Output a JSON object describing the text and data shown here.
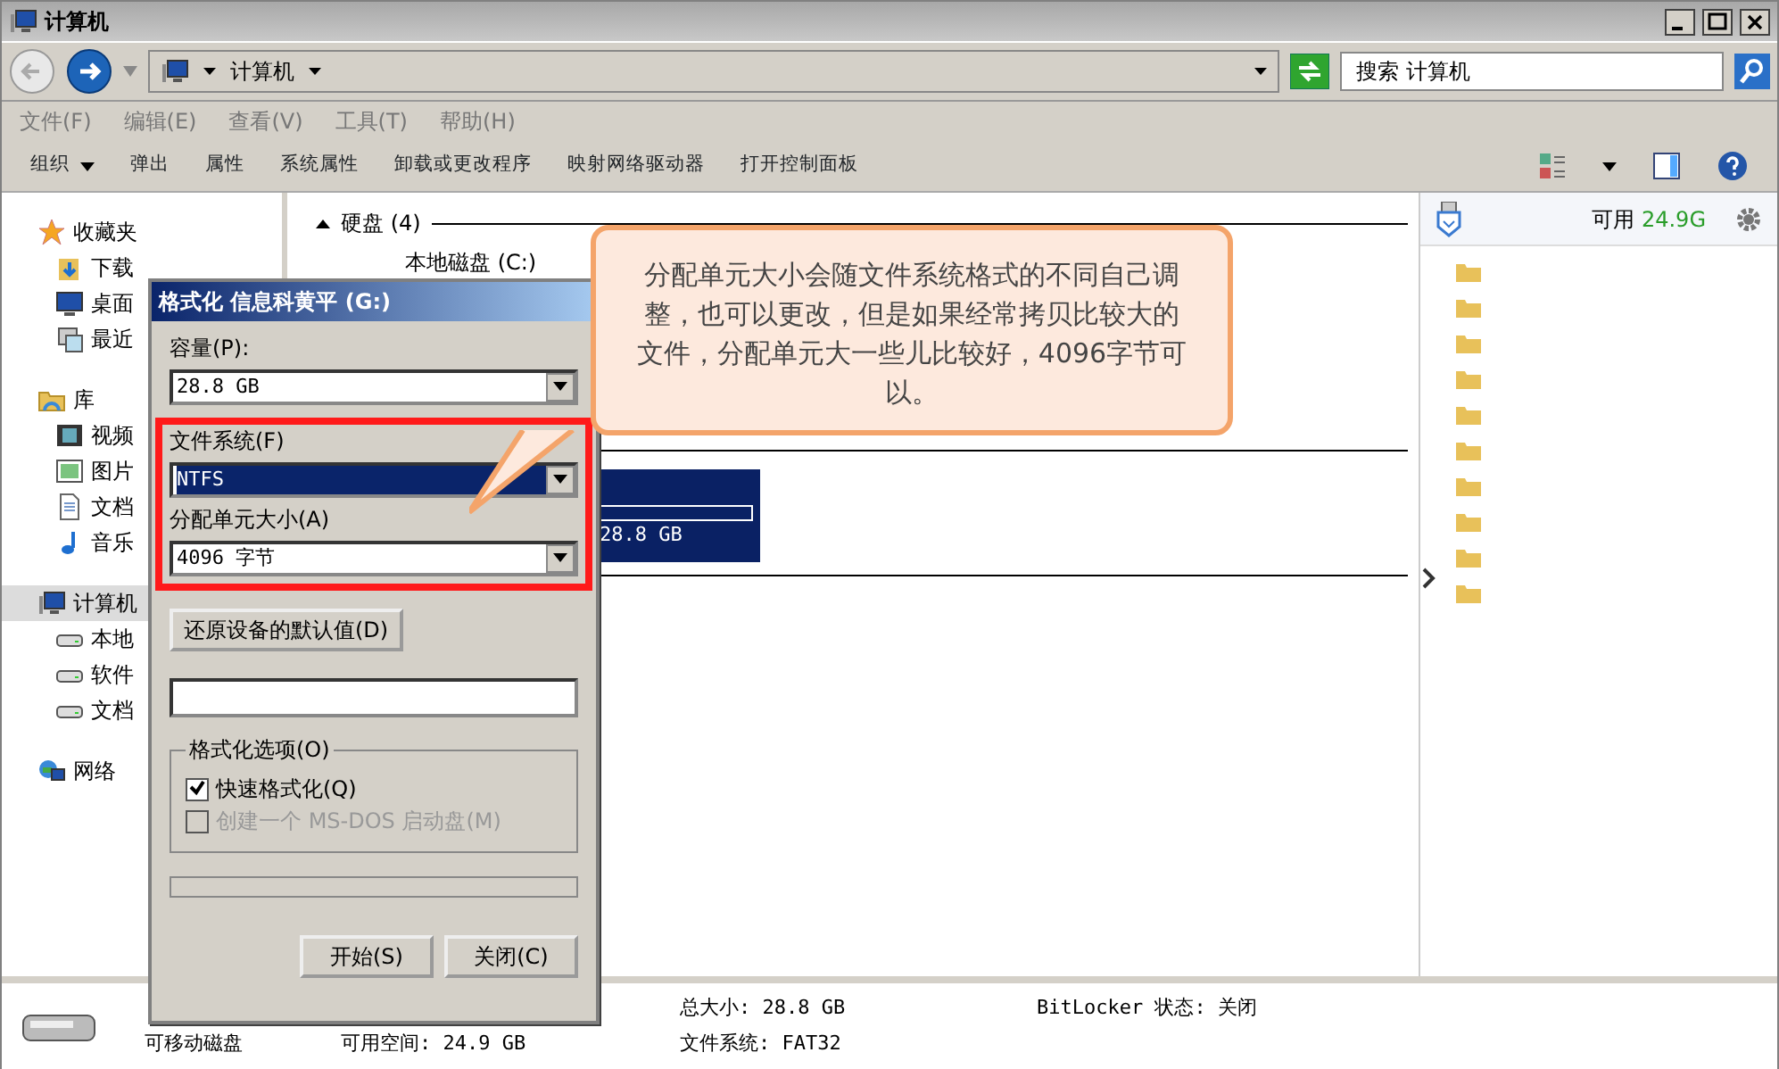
{
  "window": {
    "title": "计算机"
  },
  "address": {
    "path": "计算机",
    "search_placeholder": "搜索 计算机"
  },
  "menu": [
    "文件(F)",
    "编辑(E)",
    "查看(V)",
    "工具(T)",
    "帮助(H)"
  ],
  "toolbar": [
    {
      "label": "组织",
      "dropdown": true
    },
    {
      "label": "弹出",
      "dropdown": false
    },
    {
      "label": "属性",
      "dropdown": false
    },
    {
      "label": "系统属性",
      "dropdown": false
    },
    {
      "label": "卸载或更改程序",
      "dropdown": false
    },
    {
      "label": "映射网络驱动器",
      "dropdown": false
    },
    {
      "label": "打开控制面板",
      "dropdown": false
    }
  ],
  "nav": [
    {
      "label": "收藏夹",
      "kind": "star",
      "selected": false,
      "children": [
        {
          "label": "下载",
          "kind": "download",
          "selected": false
        },
        {
          "label": "桌面",
          "kind": "desktop",
          "selected": false
        },
        {
          "label": "最近",
          "kind": "recent",
          "selected": false
        }
      ]
    },
    {
      "label": "库",
      "kind": "library",
      "selected": false,
      "children": [
        {
          "label": "视频",
          "kind": "video",
          "selected": false
        },
        {
          "label": "图片",
          "kind": "picture",
          "selected": false
        },
        {
          "label": "文档",
          "kind": "document",
          "selected": false
        },
        {
          "label": "音乐",
          "kind": "music",
          "selected": false
        }
      ]
    },
    {
      "label": "计算机",
      "kind": "computer",
      "selected": true,
      "children": [
        {
          "label": "本地",
          "kind": "drive",
          "selected": false
        },
        {
          "label": "软件",
          "kind": "drive",
          "selected": false
        },
        {
          "label": "文档",
          "kind": "drive",
          "selected": false
        }
      ]
    },
    {
      "label": "网络",
      "kind": "network",
      "selected": false
    }
  ],
  "drives": {
    "header": "硬盘 (4)",
    "first_drive": "本地磁盘 (C:)",
    "selected_drive": {
      "size": "28.8 GB",
      "selected": true
    }
  },
  "side_panel": {
    "free_label": "可用",
    "free_value": "24.9G"
  },
  "details": {
    "name": "可移动磁盘",
    "free_space": "可用空间: 24.9 GB",
    "total_size": "总大小: 28.8 GB",
    "file_system": "文件系统: FAT32",
    "bitlocker": "BitLocker 状态: 关闭"
  },
  "format_dialog": {
    "title": "格式化 信息科黄平 (G:)",
    "capacity_label": "容量(P):",
    "capacity": "28.8 GB",
    "fs_label": "文件系统(F)",
    "fs": "NTFS",
    "fs_focused": true,
    "unit_label": "分配单元大小(A)",
    "unit": "4096 字节",
    "restore_button": "还原设备的默认值(D)",
    "options_label": "格式化选项(O)",
    "options": [
      {
        "label": "快速格式化(Q)",
        "checked": true,
        "disabled": false
      },
      {
        "label": "创建一个 MS-DOS 启动盘(M)",
        "checked": false,
        "disabled": true
      }
    ],
    "progress": {
      "level": 0
    },
    "buttons": [
      "开始(S)",
      "关闭(C)"
    ]
  },
  "callout": {
    "text": "分配单元大小会随文件系统格式的不同自己调整，也可以更改，但是如果经常拷贝比较大的文件，分配单元大一些儿比较好，4096字节可以。"
  }
}
